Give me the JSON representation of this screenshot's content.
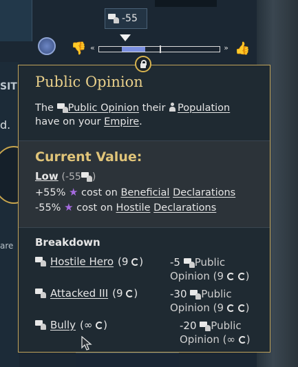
{
  "topbar": {
    "opinion_value": "-55"
  },
  "background": {
    "left_label_1": "SITI",
    "left_label_2": "d.",
    "left_label_3": "are"
  },
  "tooltip": {
    "title": "Public Opinion",
    "desc": {
      "p1": "The ",
      "link1": "Public Opinion",
      "p2": " their ",
      "link2": "Population",
      "p3": " have on your ",
      "link3": "Empire",
      "p4": "."
    },
    "current": {
      "heading": "Current Value:",
      "level": "Low",
      "level_value": "(-55",
      "level_close": ")",
      "effects": [
        {
          "pct": "+55%",
          "text": " cost on ",
          "link1": "Beneficial",
          "link2": "Declarations"
        },
        {
          "pct": "-55%",
          "text": " cost on ",
          "link1": "Hostile",
          "link2": "Declarations"
        }
      ]
    },
    "breakdown": {
      "heading": "Breakdown",
      "rows": [
        {
          "name": "Hostile Hero",
          "extra": "(9",
          "delta": "-5",
          "label1": "Public",
          "label2": "Opinion (9"
        },
        {
          "name": "Attacked III",
          "extra": "(9",
          "delta": "-30",
          "label1": "Public",
          "label2": "Opinion (9"
        },
        {
          "name": "Bully",
          "extra": "(∞",
          "delta": "-20",
          "label1": "Public",
          "label2": "Opinion (∞"
        }
      ]
    }
  },
  "opinion_scale": {
    "marker_fraction": 0.24
  },
  "colors": {
    "title_gold": "#e8cf8a",
    "border_gold": "#c2a45a",
    "star_purple": "#a66be0",
    "scale_fill": "#7b8fe0"
  }
}
